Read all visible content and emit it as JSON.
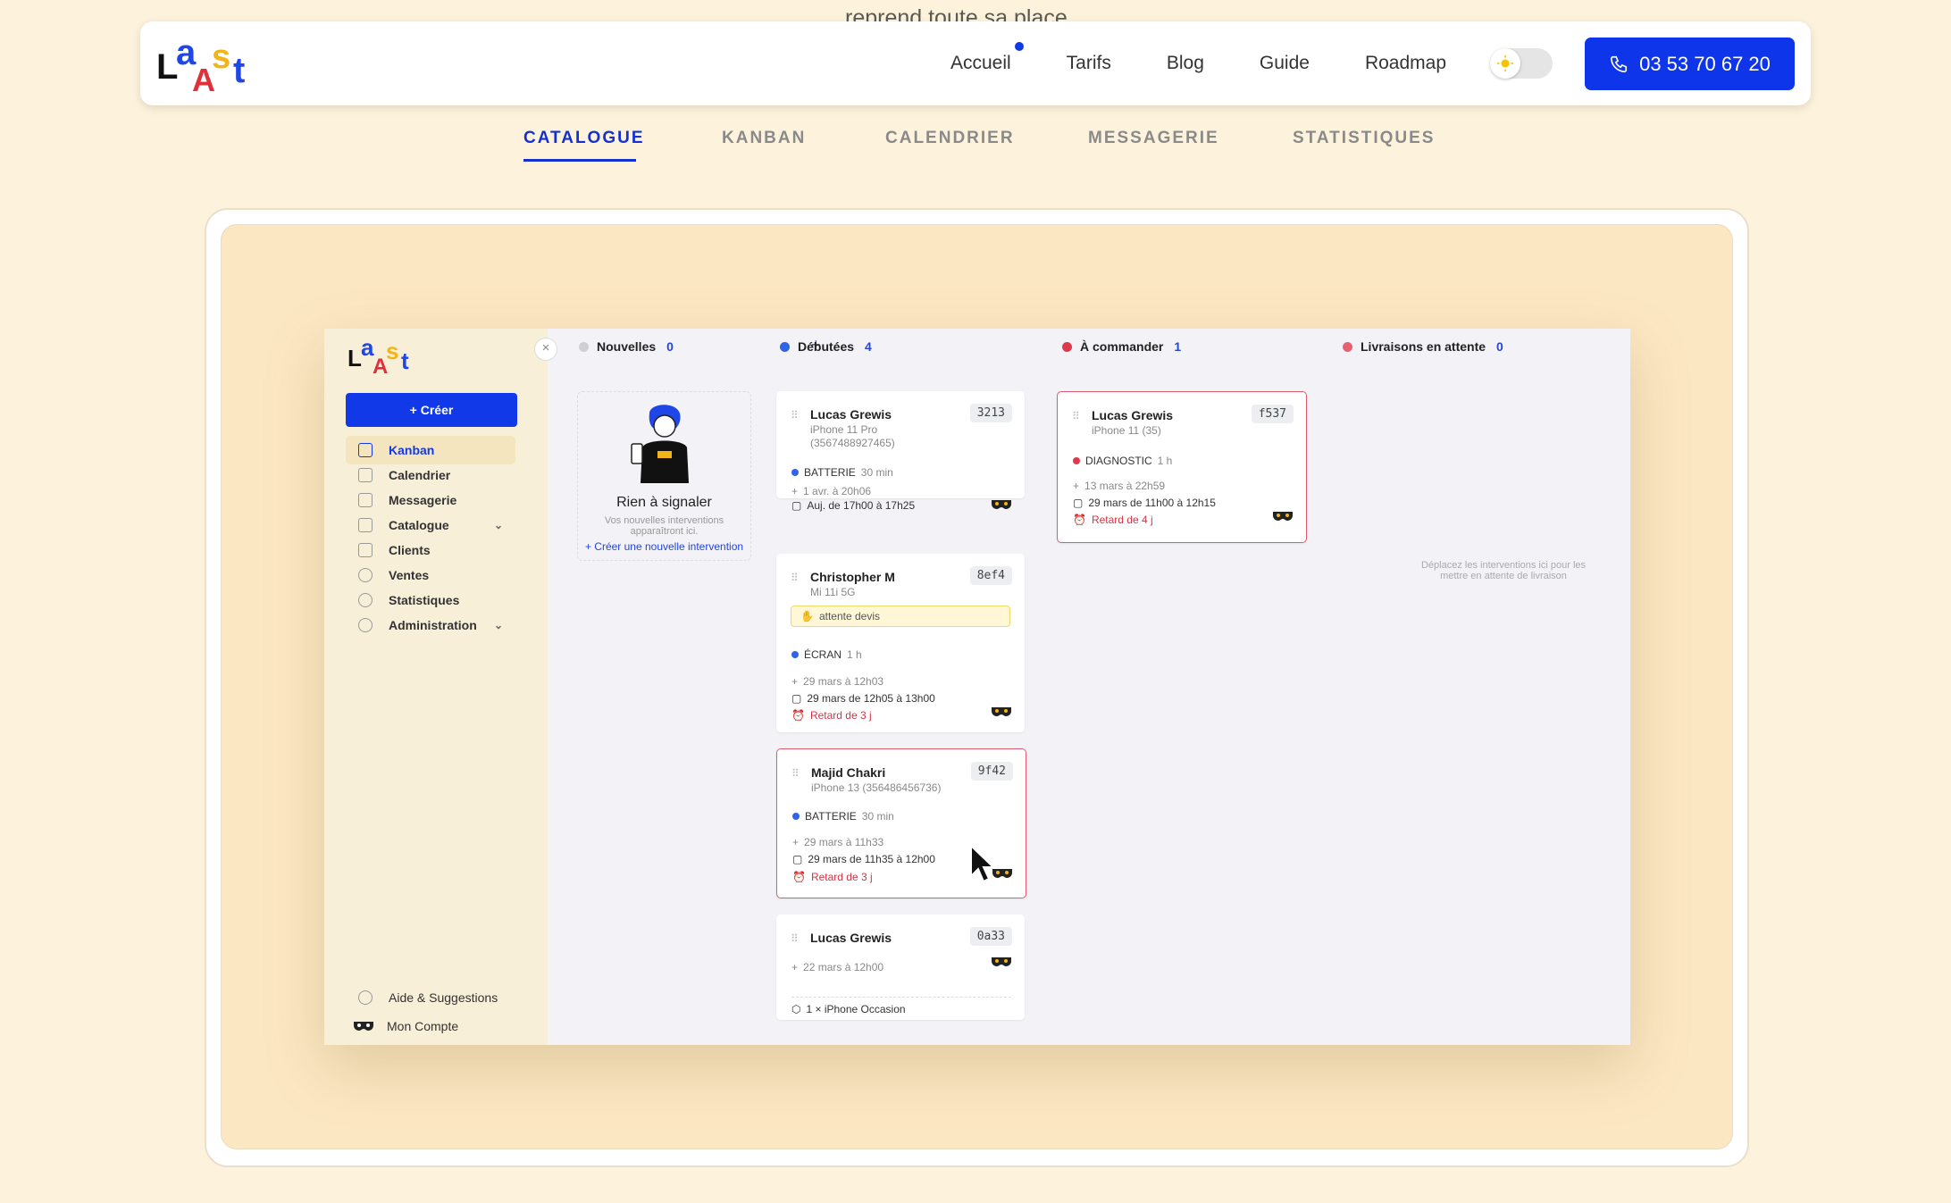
{
  "top_text": "reprend toute sa place",
  "header": {
    "nav": [
      {
        "label": "Accueil",
        "dot": true
      },
      {
        "label": "Tarifs"
      },
      {
        "label": "Blog"
      },
      {
        "label": "Guide"
      },
      {
        "label": "Roadmap"
      }
    ],
    "phone": "03 53 70 67 20"
  },
  "tabs": [
    "CATALOGUE",
    "KANBAN",
    "CALENDRIER",
    "MESSAGERIE",
    "STATISTIQUES"
  ],
  "app": {
    "create_label": "+ Créer",
    "sidebar": [
      {
        "label": "Kanban",
        "active": true
      },
      {
        "label": "Calendrier"
      },
      {
        "label": "Messagerie"
      },
      {
        "label": "Catalogue",
        "chevron": true
      },
      {
        "label": "Clients"
      },
      {
        "label": "Ventes"
      },
      {
        "label": "Statistiques"
      },
      {
        "label": "Administration",
        "chevron": true
      }
    ],
    "help": "Aide & Suggestions",
    "account": "Mon Compte",
    "columns": [
      {
        "title": "Nouvelles",
        "count": "0",
        "color": "#cfcfd4"
      },
      {
        "title": "Débutées",
        "count": "4",
        "color": "#2f63e8"
      },
      {
        "title": "À commander",
        "count": "1",
        "color": "#e0384a"
      },
      {
        "title": "Livraisons en attente",
        "count": "0",
        "color": "#e96170"
      }
    ],
    "empty": {
      "title": "Rien à signaler",
      "subtitle": "Vos nouvelles interventions apparaîtront ici.",
      "link": "+ Créer une nouvelle intervention"
    },
    "cards": {
      "c1": {
        "name": "Lucas Grewis",
        "code": "3213",
        "device": "iPhone 11 Pro",
        "imei": "(356748892746​5)",
        "task": "BATTERIE",
        "duration": "30 min",
        "created": "1 avr. à 20h06",
        "slot": "Auj. de 17h00 à 17h25"
      },
      "c2": {
        "name": "Christopher M",
        "code": "8ef4",
        "device": "Mi 11i 5G",
        "badge": "attente devis",
        "task": "ÉCRAN",
        "duration": "1 h",
        "created": "29 mars à 12h03",
        "slot": "29 mars de 12h05 à 13h00",
        "late": "Retard de 3 j"
      },
      "c3": {
        "name": "Majid Chakri",
        "code": "9f42",
        "device": "iPhone 13 (356486456736)",
        "task": "BATTERIE",
        "duration": "30 min",
        "created": "29 mars à 11h33",
        "slot": "29 mars de 11h35 à 12h00",
        "late": "Retard de 3 j"
      },
      "c4": {
        "name": "Lucas Grewis",
        "code": "0a33",
        "created": "22 mars à 12h00",
        "item": "1 × iPhone Occasion"
      },
      "c5": {
        "name": "Lucas Grewis",
        "code": "f537",
        "device": "iPhone 11 (35)",
        "task": "DIAGNOSTIC",
        "duration": "1 h",
        "created": "13 mars à 22h59",
        "slot": "29 mars de 11h00 à 12h15",
        "late": "Retard de 4 j"
      }
    },
    "drop_hint": "Déplacez les interventions ici pour les mettre en attente de livraison"
  }
}
